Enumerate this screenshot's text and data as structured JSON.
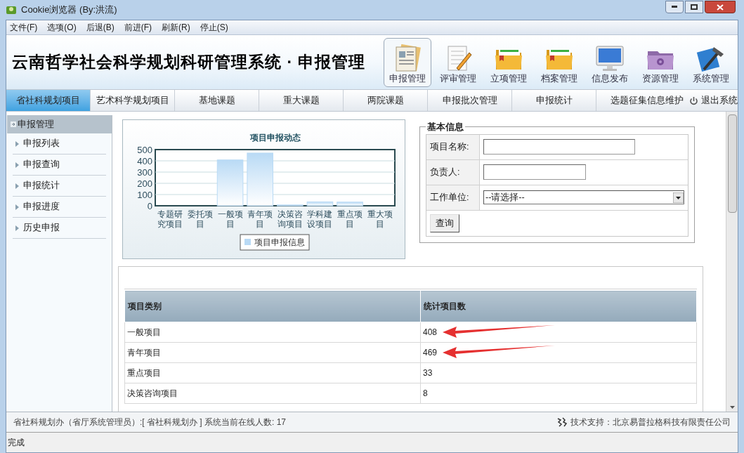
{
  "window": {
    "title": "Cookie浏览器 (By:洪流)"
  },
  "menu": [
    "文件(F)",
    "选项(O)",
    "后退(B)",
    "前进(F)",
    "刷新(R)",
    "停止(S)"
  ],
  "header": {
    "title": "云南哲学社会科学规划科研管理系统 · 申报管理"
  },
  "modules": [
    {
      "label": "申报管理",
      "kind": "news",
      "selected": true
    },
    {
      "label": "评审管理",
      "kind": "notepad",
      "selected": false
    },
    {
      "label": "立项管理",
      "kind": "folder",
      "selected": false
    },
    {
      "label": "档案管理",
      "kind": "folder",
      "selected": false
    },
    {
      "label": "信息发布",
      "kind": "monitor",
      "selected": false
    },
    {
      "label": "资源管理",
      "kind": "gearfolder",
      "selected": false
    },
    {
      "label": "系统管理",
      "kind": "tools",
      "selected": false
    }
  ],
  "tabs": [
    {
      "label": "省社科规划项目",
      "selected": true
    },
    {
      "label": "艺术科学规划项目",
      "selected": false
    },
    {
      "label": "基地课题",
      "selected": false
    },
    {
      "label": "重大课题",
      "selected": false
    },
    {
      "label": "两院课题",
      "selected": false
    },
    {
      "label": "申报批次管理",
      "selected": false
    },
    {
      "label": "申报统计",
      "selected": false
    },
    {
      "label": "选题征集信息维护",
      "selected": false
    }
  ],
  "logout": "退出系统",
  "sidebar": {
    "title": "申报管理",
    "items": [
      "申报列表",
      "申报查询",
      "申报统计",
      "申报进度",
      "历史申报"
    ]
  },
  "chart": {
    "chart_data": {
      "type": "bar",
      "grid": true,
      "title": "项目申报动态",
      "categories": [
        "专题研究项目",
        "委托项目",
        "一般项目",
        "青年项目",
        "决策咨询项目",
        "学科建设项目",
        "重点项目",
        "重大项目"
      ],
      "series": [
        {
          "name": "项目申报信息",
          "color": "#b9daf5",
          "values": [
            0,
            0,
            408,
            469,
            8,
            35,
            33,
            0
          ]
        }
      ],
      "ylim": [
        0,
        500
      ],
      "yticks": [
        0,
        100,
        200,
        300,
        400,
        500
      ]
    }
  },
  "search": {
    "legend": "基本信息",
    "fields": [
      {
        "label": "项目名称:",
        "kind": "text"
      },
      {
        "label": "负责人:",
        "kind": "text"
      },
      {
        "label": "工作单位:",
        "kind": "select",
        "value": "--请选择--"
      }
    ],
    "button": "查询"
  },
  "table": {
    "columns": [
      "项目类别",
      "统计项目数"
    ],
    "rows": [
      {
        "cells": [
          "一般项目",
          "408"
        ],
        "arrow": true
      },
      {
        "cells": [
          "青年项目",
          "469"
        ],
        "arrow": true
      },
      {
        "cells": [
          "重点项目",
          "33"
        ],
        "arrow": false
      },
      {
        "cells": [
          "决策咨询项目",
          "8"
        ],
        "arrow": false
      }
    ]
  },
  "footer": {
    "user": "省社科规划办（省厅系统管理员）:[ 省社科规划办 ] 系统当前在线人数: 17",
    "support": "技术支持：北京易普拉格科技有限责任公司"
  },
  "status": "完成"
}
